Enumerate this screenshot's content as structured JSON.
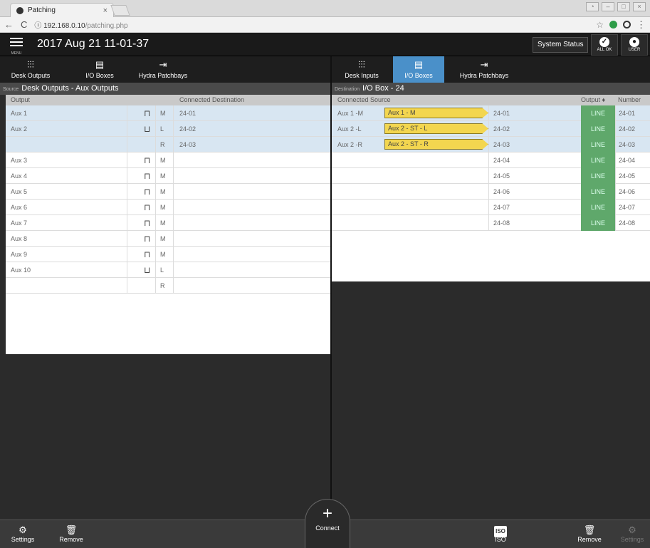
{
  "browser": {
    "tab_title": "Patching",
    "tab_close": "×",
    "url_host": "192.168.0.10",
    "url_path": "/patching.php",
    "back": "←",
    "reload": "C",
    "star": "☆",
    "menu": "⋮"
  },
  "header": {
    "menu_label": "MENU",
    "datetime": "2017 Aug 21 11-01-37",
    "system_status": "System Status",
    "all_ok": "ALL OK",
    "user": "USER"
  },
  "left_panel": {
    "tabs": [
      {
        "label": "Desk Outputs",
        "icon": "fader-icon"
      },
      {
        "label": "I/O Boxes",
        "icon": "io-box-icon"
      },
      {
        "label": "Hydra Patchbays",
        "icon": "patchbay-icon"
      }
    ],
    "context_prefix": "Source",
    "context_title": "Desk Outputs - Aux Outputs",
    "columns": {
      "output": "Output",
      "destination": "Connected Destination"
    },
    "rows": [
      {
        "name": "Aux 1",
        "icon": "mono-icon",
        "channel": "M",
        "dest": "24-01",
        "selected": true
      },
      {
        "name": "Aux 2",
        "icon": "stereo-icon",
        "channel": "L",
        "dest": "24-02",
        "selected": true
      },
      {
        "name": "",
        "icon": "",
        "channel": "R",
        "dest": "24-03",
        "selected": true
      },
      {
        "name": "Aux 3",
        "icon": "mono-icon",
        "channel": "M",
        "dest": ""
      },
      {
        "name": "Aux 4",
        "icon": "mono-icon",
        "channel": "M",
        "dest": ""
      },
      {
        "name": "Aux 5",
        "icon": "mono-icon",
        "channel": "M",
        "dest": ""
      },
      {
        "name": "Aux 6",
        "icon": "mono-icon",
        "channel": "M",
        "dest": ""
      },
      {
        "name": "Aux 7",
        "icon": "mono-icon",
        "channel": "M",
        "dest": ""
      },
      {
        "name": "Aux 8",
        "icon": "mono-icon",
        "channel": "M",
        "dest": ""
      },
      {
        "name": "Aux 9",
        "icon": "mono-icon",
        "channel": "M",
        "dest": ""
      },
      {
        "name": "Aux 10",
        "icon": "stereo-icon",
        "channel": "L",
        "dest": ""
      },
      {
        "name": "",
        "icon": "",
        "channel": "R",
        "dest": ""
      }
    ]
  },
  "right_panel": {
    "tabs": [
      {
        "label": "Desk Inputs",
        "icon": "fader-icon"
      },
      {
        "label": "I/O Boxes",
        "icon": "io-box-icon",
        "active": true
      },
      {
        "label": "Hydra Patchbays",
        "icon": "patchbay-icon"
      }
    ],
    "context_prefix": "Destination",
    "context_title": "I/O Box - 24",
    "columns": {
      "source": "Connected Source",
      "output": "Output ♦",
      "number": "Number"
    },
    "rows": [
      {
        "source": "Aux 1 -M",
        "tag": "Aux 1 - M",
        "dest": "24-01",
        "output": "LINE",
        "number": "24-01",
        "selected": true
      },
      {
        "source": "Aux 2 -L",
        "tag": "Aux 2 - ST - L",
        "dest": "24-02",
        "output": "LINE",
        "number": "24-02",
        "selected": true
      },
      {
        "source": "Aux 2 -R",
        "tag": "Aux 2 - ST - R",
        "dest": "24-03",
        "output": "LINE",
        "number": "24-03",
        "selected": true
      },
      {
        "source": "",
        "tag": "",
        "dest": "24-04",
        "output": "LINE",
        "number": "24-04"
      },
      {
        "source": "",
        "tag": "",
        "dest": "24-05",
        "output": "LINE",
        "number": "24-05"
      },
      {
        "source": "",
        "tag": "",
        "dest": "24-06",
        "output": "LINE",
        "number": "24-06"
      },
      {
        "source": "",
        "tag": "",
        "dest": "24-07",
        "output": "LINE",
        "number": "24-07"
      },
      {
        "source": "",
        "tag": "",
        "dest": "24-08",
        "output": "LINE",
        "number": "24-08"
      }
    ]
  },
  "bottom": {
    "settings": "Settings",
    "remove": "Remove",
    "connect": "Connect",
    "iso_icon": "ISO",
    "iso": "ISO",
    "remove_right": "Remove",
    "settings_right": "Settings"
  },
  "colors": {
    "accent": "#4a90c9",
    "line_green": "#5fa86b",
    "tag_yellow": "#f3d64f",
    "selected_row": "#d8e6f2"
  }
}
